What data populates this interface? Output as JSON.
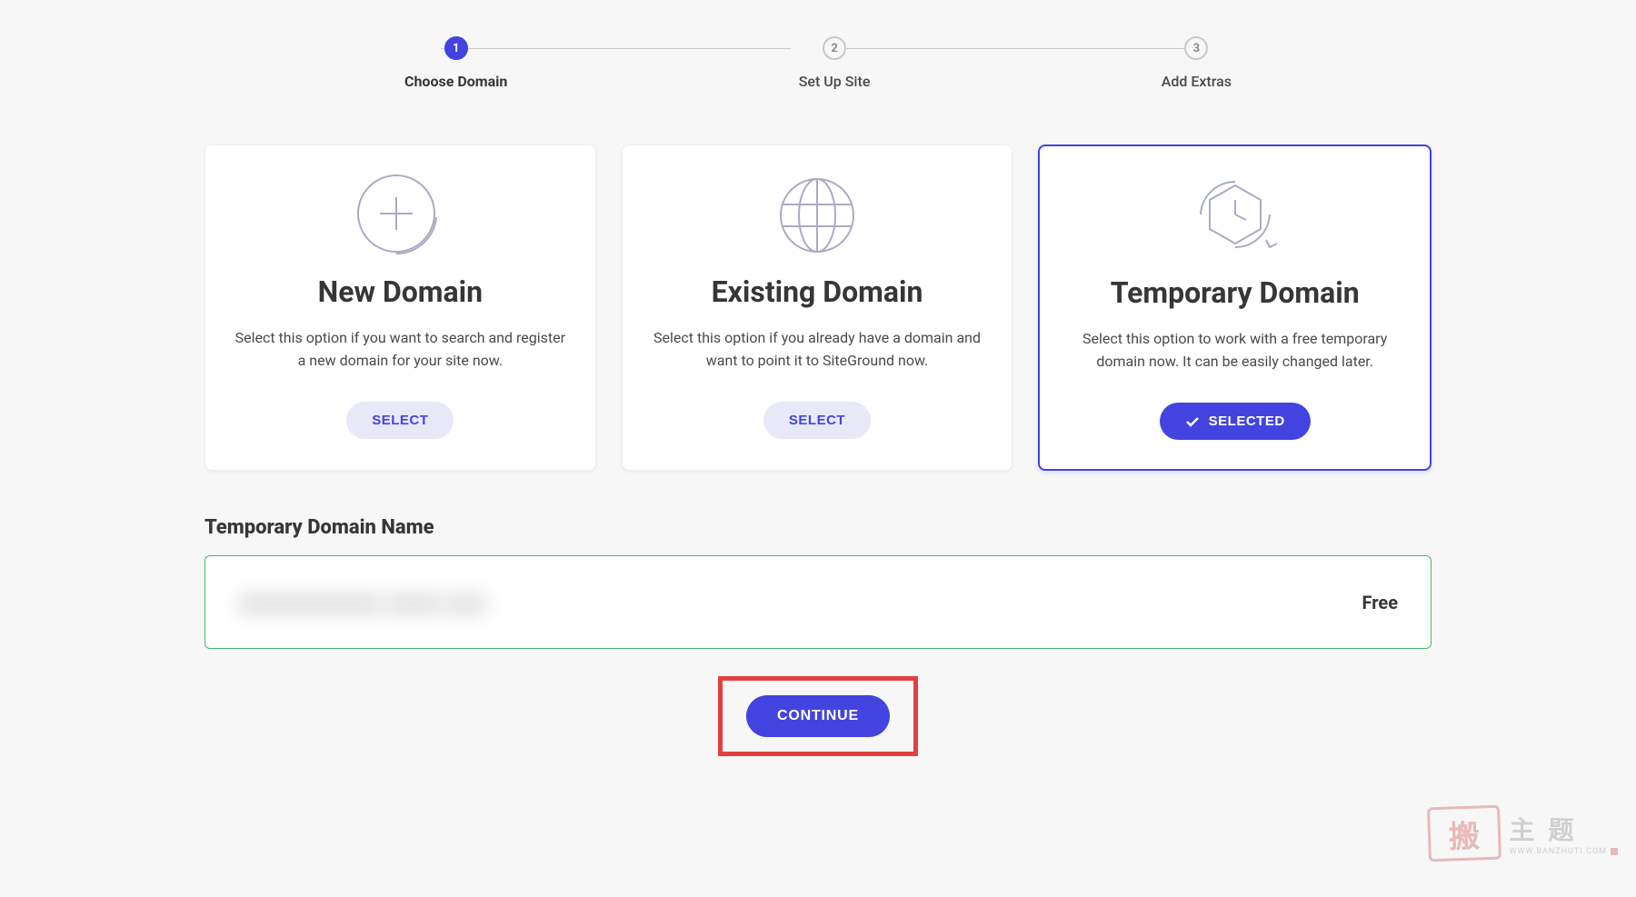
{
  "stepper": {
    "steps": [
      {
        "num": "1",
        "label": "Choose Domain"
      },
      {
        "num": "2",
        "label": "Set Up Site"
      },
      {
        "num": "3",
        "label": "Add Extras"
      }
    ],
    "activeIndex": 0
  },
  "cards": [
    {
      "title": "New Domain",
      "desc": "Select this option if you want to search and register a new domain for your site now.",
      "button": "SELECT",
      "selected": false
    },
    {
      "title": "Existing Domain",
      "desc": "Select this option if you already have a domain and want to point it to SiteGround now.",
      "button": "SELECT",
      "selected": false
    },
    {
      "title": "Temporary Domain",
      "desc": "Select this option to work with a free temporary domain now. It can be easily changed later.",
      "button": "SELECTED",
      "selected": true
    }
  ],
  "domainSection": {
    "title": "Temporary Domain Name",
    "blurredText": "xxxxxxxxxxx.xxxx.xxx",
    "price": "Free"
  },
  "continue": {
    "label": "CONTINUE"
  },
  "watermark": {
    "stamp": "搬",
    "main": "主 题",
    "sub": "WWW.BANZHUTI.COM"
  }
}
